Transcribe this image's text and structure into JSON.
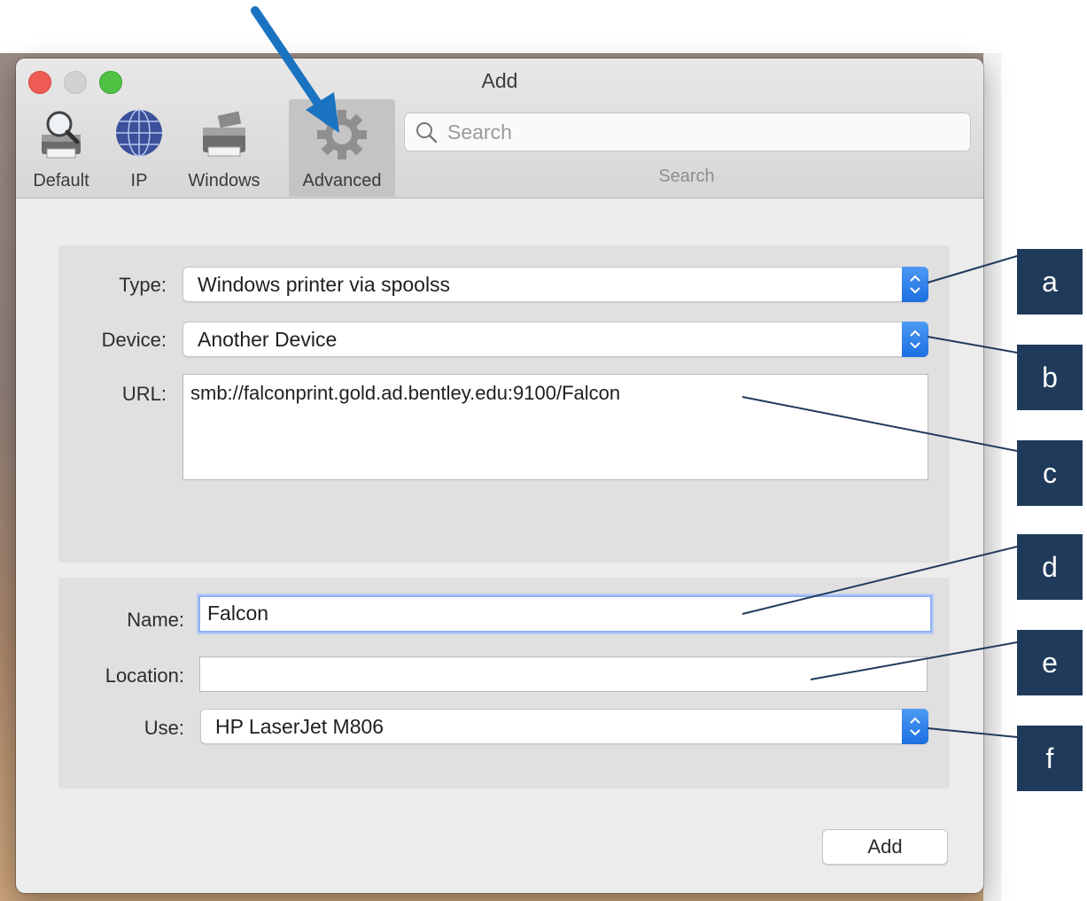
{
  "window": {
    "title": "Add"
  },
  "toolbar": {
    "tabs": [
      {
        "label": "Default",
        "icon": "default-printer-icon"
      },
      {
        "label": "IP",
        "icon": "globe-icon"
      },
      {
        "label": "Windows",
        "icon": "windows-printer-icon"
      },
      {
        "label": "Advanced",
        "icon": "gear-icon",
        "selected": true
      }
    ],
    "search": {
      "placeholder": "Search",
      "caption": "Search"
    }
  },
  "form": {
    "type": {
      "label": "Type:",
      "value": "Windows printer via spoolss"
    },
    "device": {
      "label": "Device:",
      "value": "Another Device"
    },
    "url": {
      "label": "URL:",
      "value": "smb://falconprint.gold.ad.bentley.edu:9100/Falcon"
    },
    "name": {
      "label": "Name:",
      "value": "Falcon"
    },
    "location": {
      "label": "Location:",
      "value": ""
    },
    "use": {
      "label": "Use:",
      "value": "HP LaserJet M806"
    }
  },
  "buttons": {
    "add": "Add"
  },
  "annotations": {
    "callouts": [
      "a",
      "b",
      "c",
      "d",
      "e",
      "f"
    ],
    "arrow_color": "#1a73c0",
    "callout_color": "#1f3a5b"
  }
}
